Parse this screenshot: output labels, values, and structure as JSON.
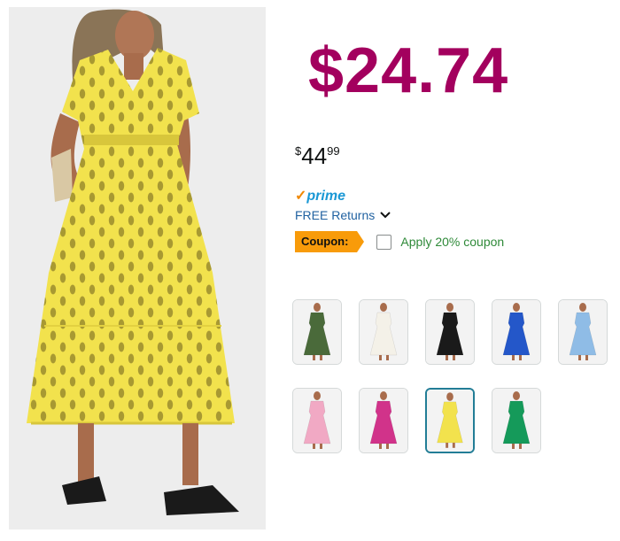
{
  "product": {
    "promo_price": "$24.74",
    "list_price": {
      "symbol": "$",
      "whole": "44",
      "fraction": "99"
    },
    "prime": {
      "check": "✓",
      "label": "prime"
    },
    "free_returns": "FREE Returns",
    "coupon": {
      "badge": "Coupon:",
      "text": "Apply 20% coupon"
    },
    "image_color": "#f2e24d"
  },
  "swatches": [
    {
      "color_hex": "#4a6a3a",
      "selected": false
    },
    {
      "color_hex": "#f4f1e8",
      "selected": false
    },
    {
      "color_hex": "#1a1a1a",
      "selected": false
    },
    {
      "color_hex": "#2457c9",
      "selected": false
    },
    {
      "color_hex": "#8fbce6",
      "selected": false
    },
    {
      "color_hex": "#f1a9c4",
      "selected": false
    },
    {
      "color_hex": "#d1338a",
      "selected": false
    },
    {
      "color_hex": "#f2e24d",
      "selected": true
    },
    {
      "color_hex": "#159a5a",
      "selected": false
    }
  ]
}
